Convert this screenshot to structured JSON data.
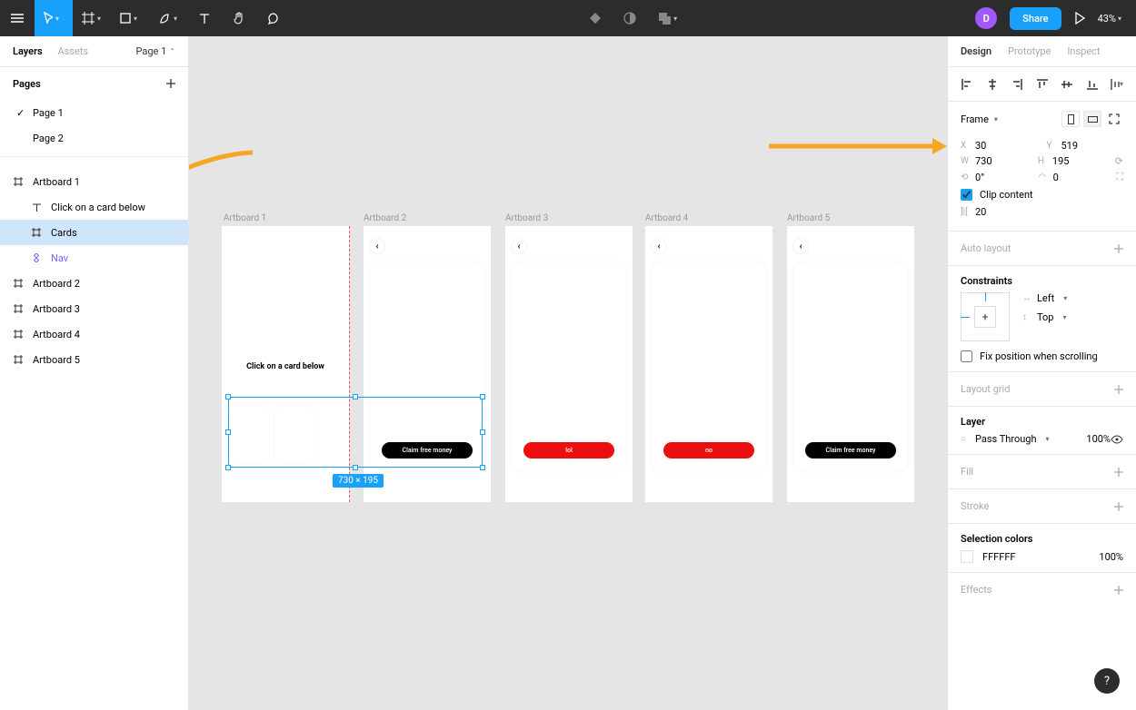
{
  "toolbar": {
    "share_label": "Share",
    "zoom": "43%",
    "avatar_initial": "D"
  },
  "left": {
    "tabs": {
      "layers": "Layers",
      "assets": "Assets",
      "page_selector": "Page 1"
    },
    "pages_header": "Pages",
    "pages": [
      "Page 1",
      "Page 2"
    ],
    "layers": {
      "artboard1": "Artboard 1",
      "text1": "Click on a card below",
      "cards": "Cards",
      "nav": "Nav",
      "artboard2": "Artboard 2",
      "artboard3": "Artboard 3",
      "artboard4": "Artboard 4",
      "artboard5": "Artboard 5"
    }
  },
  "canvas": {
    "artboards": {
      "a1": "Artboard 1",
      "a2": "Artboard 2",
      "a3": "Artboard 3",
      "a4": "Artboard 4",
      "a5": "Artboard 5"
    },
    "prompt_text": "Click on a card below",
    "buttons": {
      "claim": "Claim free money",
      "lol": "lol",
      "no": "no",
      "claim2": "Claim free money"
    },
    "selection_dim": "730 × 195"
  },
  "right": {
    "tabs": {
      "design": "Design",
      "prototype": "Prototype",
      "inspect": "Inspect"
    },
    "frame_type": "Frame",
    "x": "30",
    "y": "519",
    "w": "730",
    "h": "195",
    "rot": "0°",
    "radius": "0",
    "clip": "Clip content",
    "spacing": "20",
    "auto_layout": "Auto layout",
    "constraints": "Constraints",
    "constraint_h": "Left",
    "constraint_v": "Top",
    "fix_scroll": "Fix position when scrolling",
    "layout_grid": "Layout grid",
    "layer": "Layer",
    "blend": "Pass Through",
    "opacity": "100%",
    "fill": "Fill",
    "stroke": "Stroke",
    "selection_colors": "Selection colors",
    "sel_color": "FFFFFF",
    "sel_opacity": "100%",
    "effects": "Effects"
  }
}
